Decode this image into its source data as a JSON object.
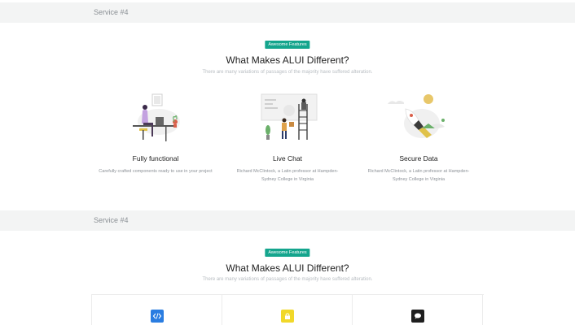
{
  "section1": {
    "band_label": "Service #4",
    "badge": "Awesome Features",
    "title": "What Makes ALUI Different?",
    "subtitle": "There are many variations of passages of the majority have suffered alteration.",
    "features": [
      {
        "title": "Fully functional",
        "desc": "Carefully crafted components ready to use in your project"
      },
      {
        "title": "Live Chat",
        "desc": "Richard McClintock, a Latin professor at Hampden-Sydney College in Virginia"
      },
      {
        "title": "Secure Data",
        "desc": "Richard McClintock, a Latin professor at Hampden-Sydney College in Virginia"
      }
    ]
  },
  "section2": {
    "band_label": "Service #4",
    "badge": "Awesome Features",
    "title": "What Makes ALUI Different?",
    "subtitle": "There are many variations of passages of the majority have suffered alteration.",
    "cards": [
      {
        "icon": "code-icon",
        "color": "#2a7de1"
      },
      {
        "icon": "lock-icon",
        "color": "#f1d82a"
      },
      {
        "icon": "chat-icon",
        "color": "#1f1f1f"
      }
    ]
  },
  "colors": {
    "accent": "#14a58d",
    "band": "#f3f4f4"
  }
}
